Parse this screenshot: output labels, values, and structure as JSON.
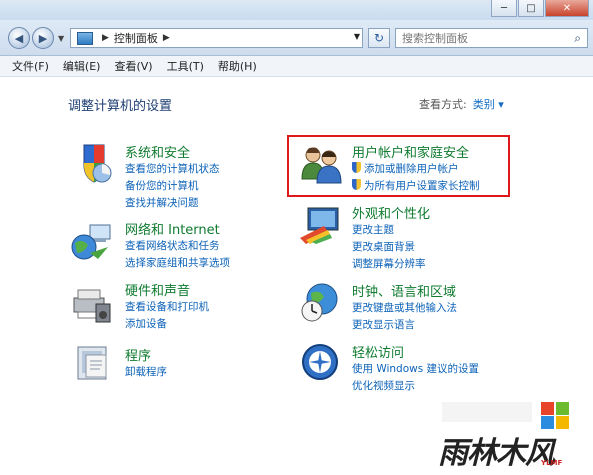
{
  "window": {
    "minimize": "─",
    "maximize": "□",
    "close": "✕"
  },
  "address": {
    "crumb": "控制面板",
    "search_placeholder": "搜索控制面板"
  },
  "menu": [
    "文件(F)",
    "编辑(E)",
    "查看(V)",
    "工具(T)",
    "帮助(H)"
  ],
  "heading": "调整计算机的设置",
  "view_by": {
    "label": "查看方式:",
    "value": "类别 ▾"
  },
  "categories": [
    {
      "title": "系统和安全",
      "links": [
        "查看您的计算机状态",
        "备份您的计算机",
        "查找并解决问题"
      ]
    },
    {
      "title": "网络和 Internet",
      "links": [
        "查看网络状态和任务",
        "选择家庭组和共享选项"
      ]
    },
    {
      "title": "硬件和声音",
      "links": [
        "查看设备和打印机",
        "添加设备"
      ]
    },
    {
      "title": "程序",
      "links": [
        "卸载程序"
      ]
    },
    {
      "title": "用户帐户和家庭安全",
      "links": [
        "添加或删除用户帐户",
        "为所有用户设置家长控制"
      ]
    },
    {
      "title": "外观和个性化",
      "links": [
        "更改主题",
        "更改桌面背景",
        "调整屏幕分辨率"
      ]
    },
    {
      "title": "时钟、语言和区域",
      "links": [
        "更改键盘或其他输入法",
        "更改显示语言"
      ]
    },
    {
      "title": "轻松访问",
      "links": [
        "使用 Windows 建议的设置",
        "优化视频显示"
      ]
    }
  ],
  "watermark": {
    "text": "雨林木风",
    "sub": "YLMF"
  }
}
